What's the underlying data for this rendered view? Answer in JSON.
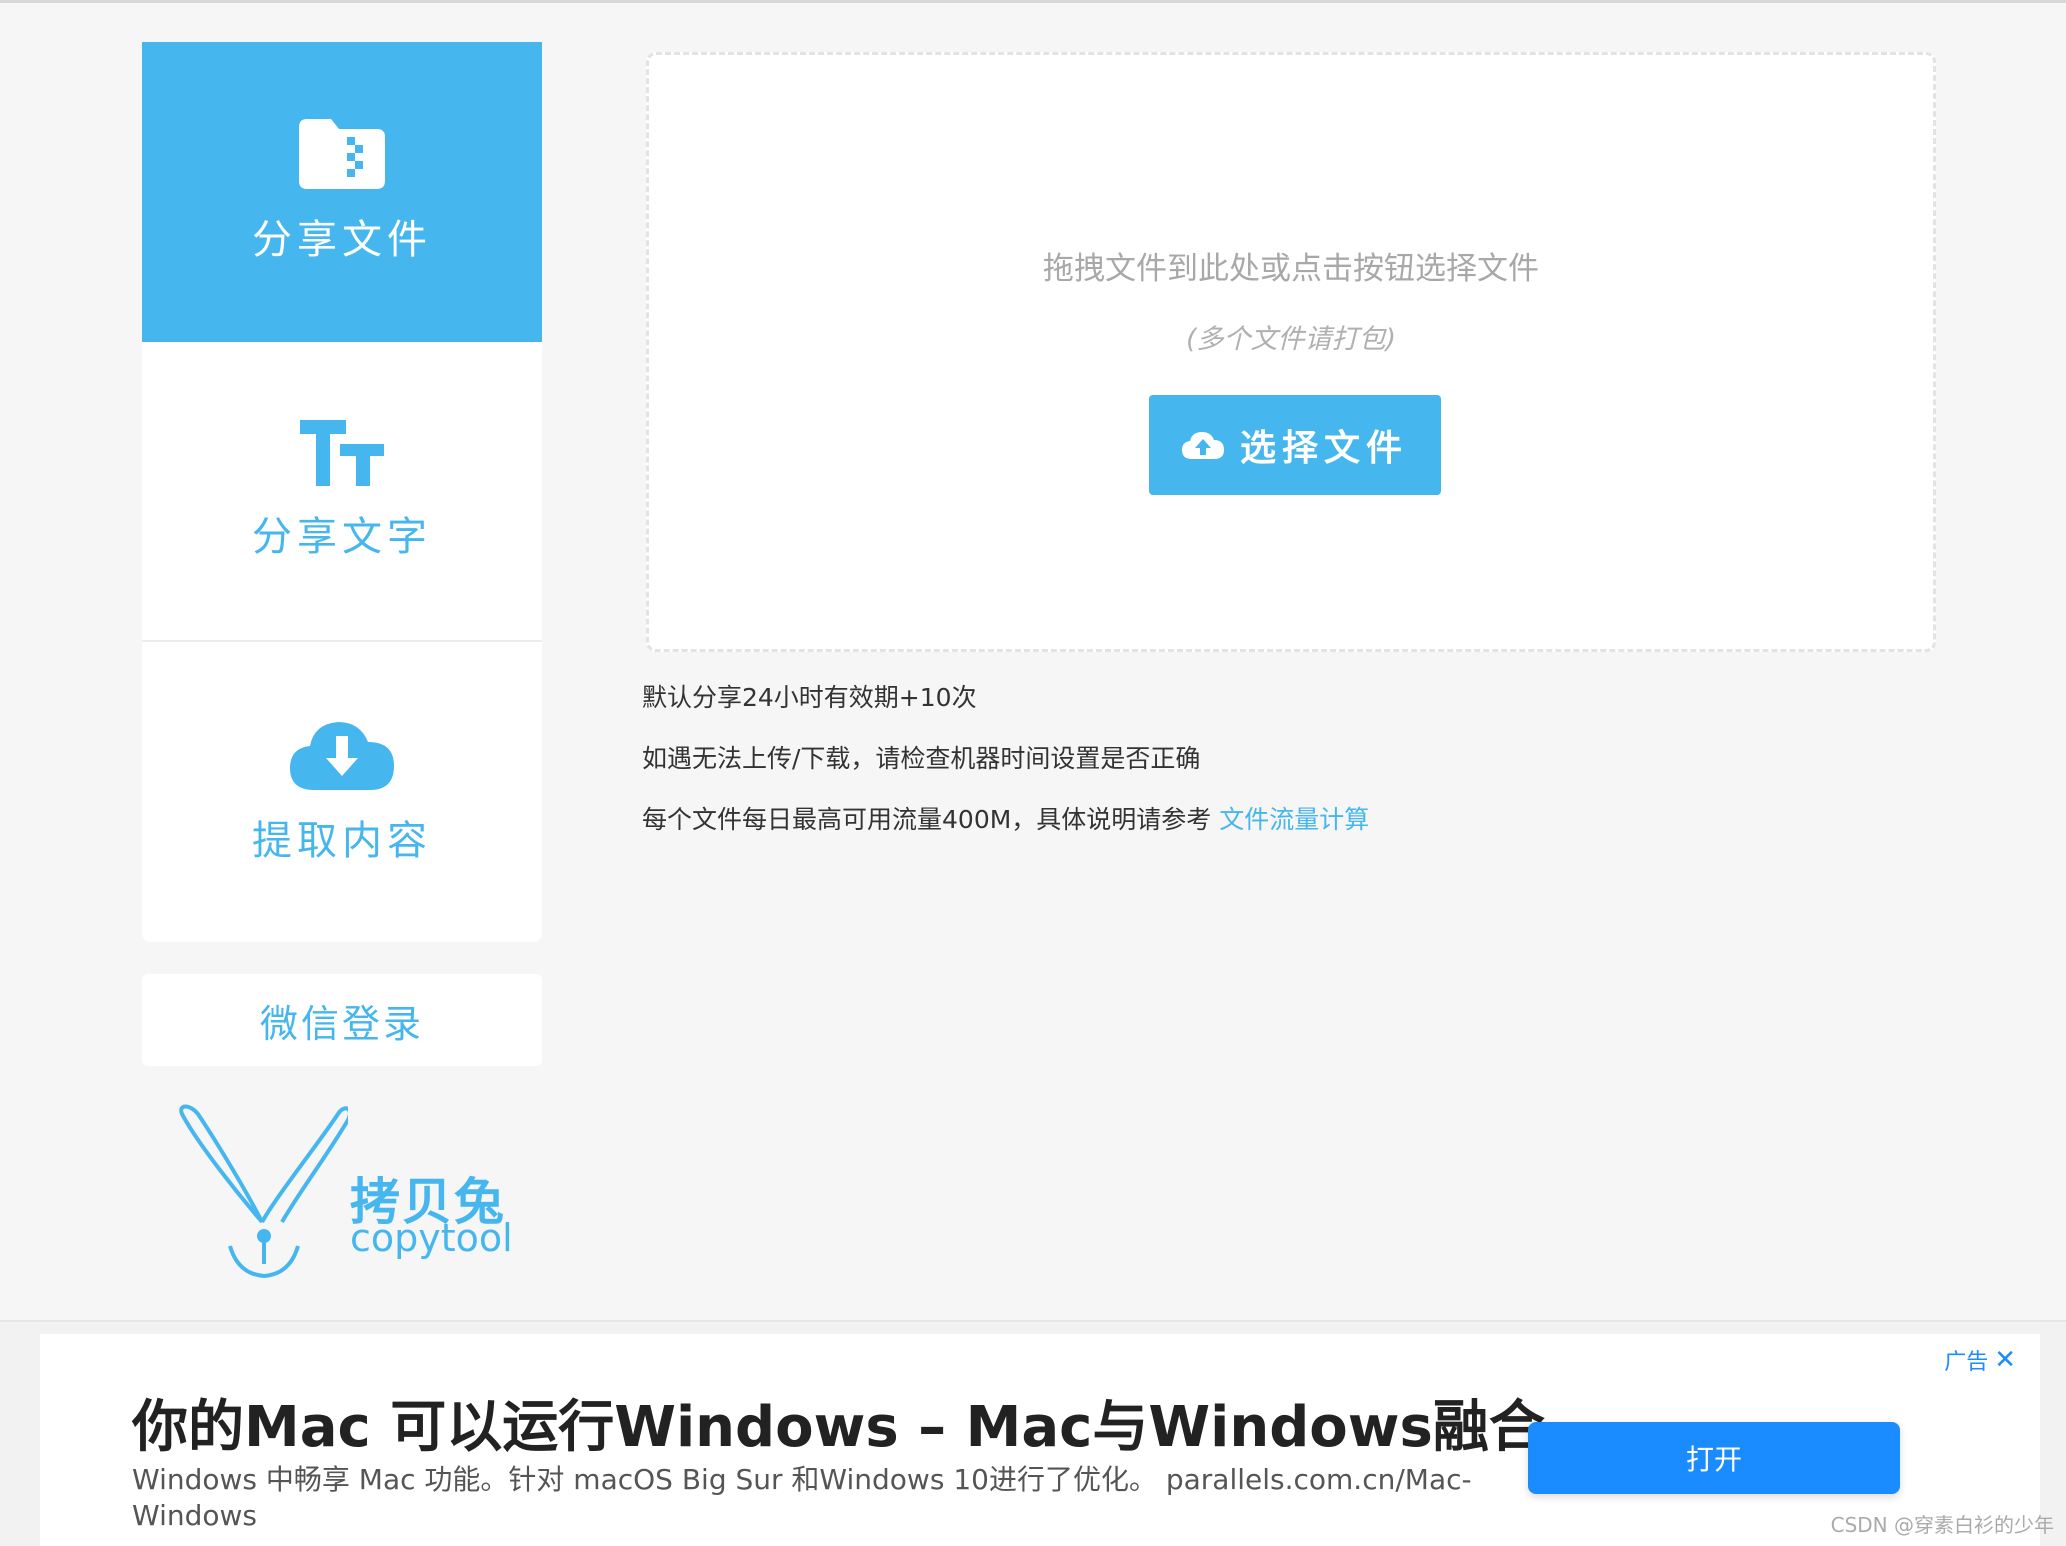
{
  "sidebar": {
    "items": [
      {
        "label": "分享文件",
        "icon": "zip-folder-icon"
      },
      {
        "label": "分享文字",
        "icon": "text-size-icon"
      },
      {
        "label": "提取内容",
        "icon": "cloud-download-icon"
      }
    ],
    "wechat_login": "微信登录"
  },
  "logo": {
    "name_cn": "拷贝兔",
    "name_en": "copytool"
  },
  "upload": {
    "hint": "拖拽文件到此处或点击按钮选择文件",
    "sub_hint": "(多个文件请打包)",
    "button_label": "选择文件"
  },
  "notes": {
    "line1": "默认分享24小时有效期+10次",
    "line2": "如遇无法上传/下载，请检查机器时间设置是否正确",
    "line3": "每个文件每日最高可用流量400M，具体说明请参考",
    "line3_link": "文件流量计算"
  },
  "ad": {
    "badge": "广告",
    "title": "你的Mac 可以运行Windows – Mac与Windows融合",
    "description": "Windows 中畅享 Mac 功能。针对 macOS Big Sur 和Windows 10进行了优化。 parallels.com.cn/Mac-Windows",
    "button_label": "打开"
  },
  "watermark": "CSDN @穿素白衫的少年",
  "colors": {
    "accent": "#45b6ee",
    "ad_button": "#1a8cff"
  }
}
